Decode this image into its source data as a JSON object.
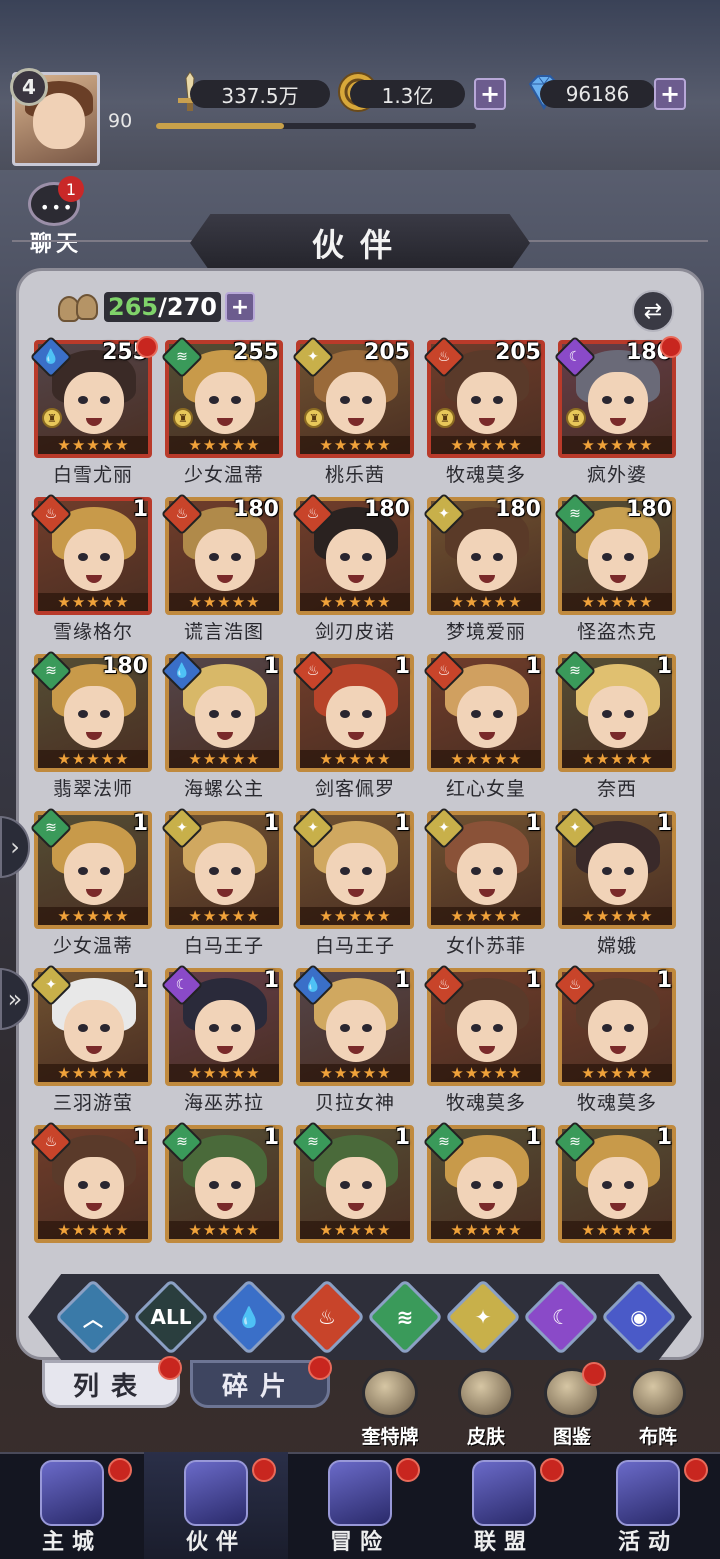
{
  "player": {
    "vip_level": "4",
    "level": "90",
    "xp_fraction": 0.4
  },
  "resources": {
    "power": "337.5万",
    "gold": "1.3亿",
    "gems": "96186"
  },
  "chat": {
    "label": "聊天",
    "badge": "1"
  },
  "page": {
    "title": "伙伴"
  },
  "roster": {
    "current": "265",
    "max": "270"
  },
  "heroes": [
    {
      "name": "白雪尤丽",
      "level": "255",
      "element": "water",
      "stars": 5,
      "red_dot": true,
      "rook": true,
      "border": "red",
      "hair": "#3a2a26"
    },
    {
      "name": "少女温蒂",
      "level": "255",
      "element": "wind",
      "stars": 5,
      "red_dot": false,
      "rook": true,
      "border": "red",
      "hair": "#c89a4a"
    },
    {
      "name": "桃乐茜",
      "level": "205",
      "element": "light",
      "stars": 5,
      "red_dot": false,
      "rook": true,
      "border": "red",
      "hair": "#9a6a3a"
    },
    {
      "name": "牧魂莫多",
      "level": "205",
      "element": "fire",
      "stars": 5,
      "red_dot": false,
      "rook": true,
      "border": "red",
      "hair": "#5a3a2a"
    },
    {
      "name": "疯外婆",
      "level": "180",
      "element": "dark",
      "stars": 5,
      "red_dot": true,
      "rook": true,
      "border": "red",
      "hair": "#6a6a78"
    },
    {
      "name": "雪缘格尔",
      "level": "1",
      "element": "fire",
      "stars": 5,
      "red_dot": false,
      "rook": false,
      "border": "red",
      "hair": "#c89a4a"
    },
    {
      "name": "谎言浩图",
      "level": "180",
      "element": "fire",
      "stars": 5,
      "red_dot": false,
      "rook": false,
      "border": "gold",
      "hair": "#b08a4a"
    },
    {
      "name": "剑刃皮诺",
      "level": "180",
      "element": "fire",
      "stars": 5,
      "red_dot": false,
      "rook": false,
      "border": "gold",
      "hair": "#2a2220"
    },
    {
      "name": "梦境爱丽",
      "level": "180",
      "element": "light",
      "stars": 5,
      "red_dot": false,
      "rook": false,
      "border": "gold",
      "hair": "#5a3a28"
    },
    {
      "name": "怪盗杰克",
      "level": "180",
      "element": "wind",
      "stars": 5,
      "red_dot": false,
      "rook": false,
      "border": "gold",
      "hair": "#c8a050"
    },
    {
      "name": "翡翠法师",
      "level": "180",
      "element": "wind",
      "stars": 5,
      "red_dot": false,
      "rook": false,
      "border": "gold",
      "hair": "#c89a4a"
    },
    {
      "name": "海螺公主",
      "level": "1",
      "element": "water",
      "stars": 5,
      "red_dot": false,
      "rook": false,
      "border": "gold",
      "hair": "#d8b868"
    },
    {
      "name": "剑客佩罗",
      "level": "1",
      "element": "fire",
      "stars": 5,
      "red_dot": false,
      "rook": false,
      "border": "gold",
      "hair": "#b8442a"
    },
    {
      "name": "红心女皇",
      "level": "1",
      "element": "fire",
      "stars": 5,
      "red_dot": false,
      "rook": false,
      "border": "gold",
      "hair": "#d0a060"
    },
    {
      "name": "奈西",
      "level": "1",
      "element": "wind",
      "stars": 5,
      "red_dot": false,
      "rook": false,
      "border": "gold",
      "hair": "#e0c070"
    },
    {
      "name": "少女温蒂",
      "level": "1",
      "element": "wind",
      "stars": 5,
      "red_dot": false,
      "rook": false,
      "border": "gold",
      "hair": "#c89a4a"
    },
    {
      "name": "白马王子",
      "level": "1",
      "element": "light",
      "stars": 5,
      "red_dot": false,
      "rook": false,
      "border": "gold",
      "hair": "#d0a860"
    },
    {
      "name": "白马王子",
      "level": "1",
      "element": "light",
      "stars": 5,
      "red_dot": false,
      "rook": false,
      "border": "gold",
      "hair": "#d0a860"
    },
    {
      "name": "女仆苏菲",
      "level": "1",
      "element": "light",
      "stars": 5,
      "red_dot": false,
      "rook": false,
      "border": "gold",
      "hair": "#8a5238"
    },
    {
      "name": "嫦娥",
      "level": "1",
      "element": "light",
      "stars": 5,
      "red_dot": false,
      "rook": false,
      "border": "gold",
      "hair": "#3a2a2a"
    },
    {
      "name": "三羽游萤",
      "level": "1",
      "element": "light",
      "stars": 5,
      "red_dot": false,
      "rook": false,
      "border": "gold",
      "hair": "#e8e8e8"
    },
    {
      "name": "海巫苏拉",
      "level": "1",
      "element": "dark",
      "stars": 5,
      "red_dot": false,
      "rook": false,
      "border": "gold",
      "hair": "#2a2a3a"
    },
    {
      "name": "贝拉女神",
      "level": "1",
      "element": "water",
      "stars": 5,
      "red_dot": false,
      "rook": false,
      "border": "gold",
      "hair": "#d0a860"
    },
    {
      "name": "牧魂莫多",
      "level": "1",
      "element": "fire",
      "stars": 5,
      "red_dot": false,
      "rook": false,
      "border": "gold",
      "hair": "#5a3a2a"
    },
    {
      "name": "牧魂莫多",
      "level": "1",
      "element": "fire",
      "stars": 5,
      "red_dot": false,
      "rook": false,
      "border": "gold",
      "hair": "#5a3a2a"
    },
    {
      "name": "",
      "level": "1",
      "element": "fire",
      "stars": 5,
      "red_dot": false,
      "rook": false,
      "border": "gold",
      "hair": "#5a3a2a"
    },
    {
      "name": "",
      "level": "1",
      "element": "wind",
      "stars": 5,
      "red_dot": false,
      "rook": false,
      "border": "gold",
      "hair": "#4a6a3a"
    },
    {
      "name": "",
      "level": "1",
      "element": "wind",
      "stars": 5,
      "red_dot": false,
      "rook": false,
      "border": "gold",
      "hair": "#4a6a3a"
    },
    {
      "name": "",
      "level": "1",
      "element": "wind",
      "stars": 5,
      "red_dot": false,
      "rook": false,
      "border": "gold",
      "hair": "#c89a4a"
    },
    {
      "name": "",
      "level": "1",
      "element": "wind",
      "stars": 5,
      "red_dot": false,
      "rook": false,
      "border": "gold",
      "hair": "#c89a4a"
    }
  ],
  "element_colors": {
    "water": "#3a6fc8",
    "wind": "#3a9a5a",
    "light": "#c8b04a",
    "fire": "#c8442a",
    "dark": "#8a4ac8",
    "cosmic": "#4a5ac8",
    "all": "#5a8a9a",
    "default": "#3a7aa8"
  },
  "filters": [
    {
      "key": "default",
      "label": "",
      "icon": "chevron-icon"
    },
    {
      "key": "all",
      "label": "ALL",
      "icon": "all-icon"
    },
    {
      "key": "water",
      "label": "",
      "icon": "water-drop-icon"
    },
    {
      "key": "fire",
      "label": "",
      "icon": "flame-icon"
    },
    {
      "key": "wind",
      "label": "",
      "icon": "wind-icon"
    },
    {
      "key": "light",
      "label": "",
      "icon": "sun-icon"
    },
    {
      "key": "dark",
      "label": "",
      "icon": "moon-icon"
    },
    {
      "key": "cosmic",
      "label": "",
      "icon": "planet-icon"
    }
  ],
  "tabs": {
    "list": "列表",
    "fragments": "碎片"
  },
  "features": [
    {
      "label": "奎特牌",
      "icon": "card-icon"
    },
    {
      "label": "皮肤",
      "icon": "outfit-icon"
    },
    {
      "label": "图鉴",
      "icon": "codex-icon"
    },
    {
      "label": "布阵",
      "icon": "formation-icon"
    }
  ],
  "nav": [
    {
      "label": "主城",
      "icon": "castle-icon",
      "active": false
    },
    {
      "label": "伙伴",
      "icon": "wizard-hat-icon",
      "active": true
    },
    {
      "label": "冒险",
      "icon": "compass-icon",
      "active": false
    },
    {
      "label": "联盟",
      "icon": "shield-icon",
      "active": false
    },
    {
      "label": "活动",
      "icon": "cards-icon",
      "active": false
    }
  ]
}
